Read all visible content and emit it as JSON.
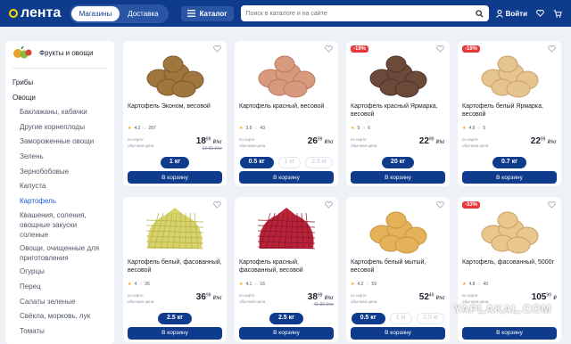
{
  "header": {
    "logo_text": "лента",
    "tabs": [
      "Магазины",
      "Доставка"
    ],
    "catalog_label": "Каталог",
    "search_placeholder": "Поиск в каталоге и на сайте",
    "login_label": "Войти"
  },
  "sidebar": {
    "category_title": "Фрукты и овощи",
    "items": [
      {
        "label": "Грибы",
        "level": 0
      },
      {
        "label": "Овощи",
        "level": 0
      },
      {
        "label": "Баклажаны, кабачки",
        "level": 1
      },
      {
        "label": "Другие корнеплоды",
        "level": 1
      },
      {
        "label": "Замороженные овощи",
        "level": 1
      },
      {
        "label": "Зелень",
        "level": 1
      },
      {
        "label": "Зернобобовые",
        "level": 1
      },
      {
        "label": "Капуста",
        "level": 1
      },
      {
        "label": "Картофель",
        "level": 1,
        "active": true
      },
      {
        "label": "Квашения, соления, овощные закуски соленые",
        "level": 1
      },
      {
        "label": "Овощи, очищенные для приготовления",
        "level": 1
      },
      {
        "label": "Огурцы",
        "level": 1
      },
      {
        "label": "Перец",
        "level": 1
      },
      {
        "label": "Салаты зеленые",
        "level": 1
      },
      {
        "label": "Свёкла, морковь, лук",
        "level": 1
      },
      {
        "label": "Томаты",
        "level": 1
      }
    ]
  },
  "labels": {
    "card_label": "по карте",
    "regular_label": "обычная цена",
    "cart_button": "В корзину"
  },
  "products": [
    {
      "name": "Картофель Эконом, весовой",
      "rating": "4.2",
      "reviews": "287",
      "price": "18",
      "kop": "99",
      "unit": "₽/кг",
      "old": "19 99 ₽/кг",
      "discount": "",
      "weights": [
        {
          "label": "1 кг",
          "active": true
        }
      ],
      "img": "brown"
    },
    {
      "name": "Картофель красный, весовой",
      "rating": "3.9",
      "reviews": "43",
      "price": "26",
      "kop": "99",
      "unit": "₽/кг",
      "old": "",
      "discount": "",
      "weights": [
        {
          "label": "0.5 кг",
          "active": true
        },
        {
          "label": "1 кг",
          "active": false
        },
        {
          "label": "2.5 кг",
          "active": false
        }
      ],
      "img": "pink"
    },
    {
      "name": "Картофель красный Ярмарка, весовой",
      "rating": "5",
      "reviews": "6",
      "price": "22",
      "kop": "99",
      "unit": "₽/кг",
      "old": "",
      "discount": "-19%",
      "weights": [
        {
          "label": "20 кг",
          "active": true
        }
      ],
      "img": "dark"
    },
    {
      "name": "Картофель белый Ярмарка, весовой",
      "rating": "4.9",
      "reviews": "5",
      "price": "22",
      "kop": "99",
      "unit": "₽/кг",
      "old": "",
      "discount": "-19%",
      "weights": [
        {
          "label": "0.7 кг",
          "active": true
        }
      ],
      "img": "light"
    },
    {
      "name": "Картофель белый, фасованный, весовой",
      "rating": "4",
      "reviews": "26",
      "price": "36",
      "kop": "99",
      "unit": "₽/кг",
      "old": "",
      "discount": "",
      "weights": [
        {
          "label": "2.5 кг",
          "active": true
        }
      ],
      "img": "net-yellow"
    },
    {
      "name": "Картофель красный, фасованный, весовой",
      "rating": "4.1",
      "reviews": "16",
      "price": "38",
      "kop": "99",
      "unit": "₽/кг",
      "old": "41 99 ₽/кг",
      "discount": "",
      "weights": [
        {
          "label": "2.5 кг",
          "active": true
        }
      ],
      "img": "net-red"
    },
    {
      "name": "Картофель белый мытый, весовой",
      "rating": "4.2",
      "reviews": "59",
      "price": "52",
      "kop": "49",
      "unit": "₽/кг",
      "old": "",
      "discount": "",
      "weights": [
        {
          "label": "0.5 кг",
          "active": true
        },
        {
          "label": "1 кг",
          "active": false
        },
        {
          "label": "2.5 кг",
          "active": false
        }
      ],
      "img": "washed"
    },
    {
      "name": "Картофель, фасованный, 5000г",
      "rating": "4.8",
      "reviews": "40",
      "price": "105",
      "kop": "99",
      "unit": "₽",
      "old": "",
      "discount": "-33%",
      "weights": [],
      "img": "pile"
    }
  ],
  "watermark": "YAPLAKAL.COM",
  "colors": {
    "brand": "#0e3b8c",
    "accent": "#ffd400",
    "discount": "#e8363b",
    "active_link": "#1f5bd4"
  }
}
